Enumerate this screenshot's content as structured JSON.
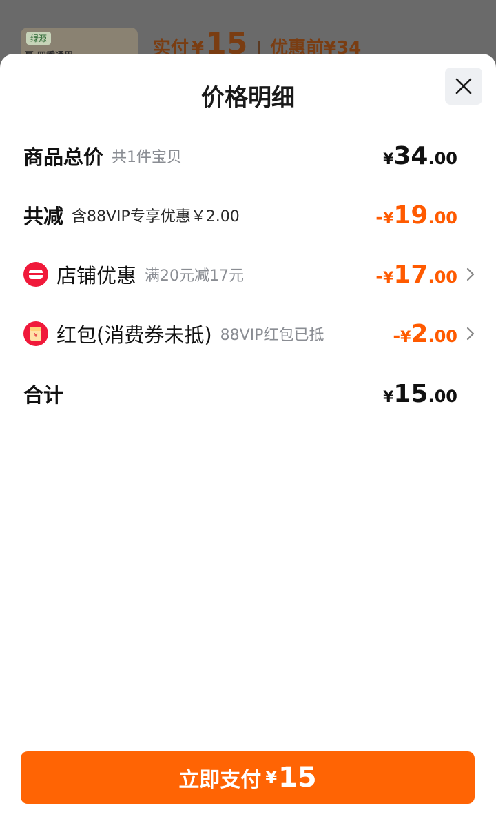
{
  "background": {
    "product_brand": "绿源",
    "product_name": "夏·四季通用",
    "paid_label": "实付",
    "paid_yen": "¥",
    "paid_amount": "15",
    "separator": "|",
    "before_label": "优惠前",
    "before_yen": "¥",
    "before_amount": "34"
  },
  "sheet": {
    "title": "价格明细"
  },
  "rows": {
    "total": {
      "title": "商品总价",
      "note": "共1件宝贝",
      "neg": "",
      "yen": "¥",
      "int": "34",
      "dec": ".00"
    },
    "reduce": {
      "title": "共减",
      "note": "含88VIP专享优惠￥2.00",
      "neg": "-",
      "yen": "¥",
      "int": "19",
      "dec": ".00"
    },
    "shop": {
      "title": "店铺优惠",
      "note": "满20元减17元",
      "neg": "-",
      "yen": "¥",
      "int": "17",
      "dec": ".00",
      "icon": "shop-coupon-icon"
    },
    "redpacket": {
      "title": "红包(消费券未抵)",
      "note": "88VIP红包已抵",
      "neg": "-",
      "yen": "¥",
      "int": "2",
      "dec": ".00",
      "icon": "red-packet-icon"
    },
    "sum": {
      "title": "合计",
      "yen": "¥",
      "int": "15",
      "dec": ".00"
    }
  },
  "pay_button": {
    "label": "立即支付",
    "yen": "¥",
    "amount": "15"
  },
  "colors": {
    "accent": "#ff6404",
    "discount": "#ff5a00",
    "icon_red": "#f0193a"
  }
}
